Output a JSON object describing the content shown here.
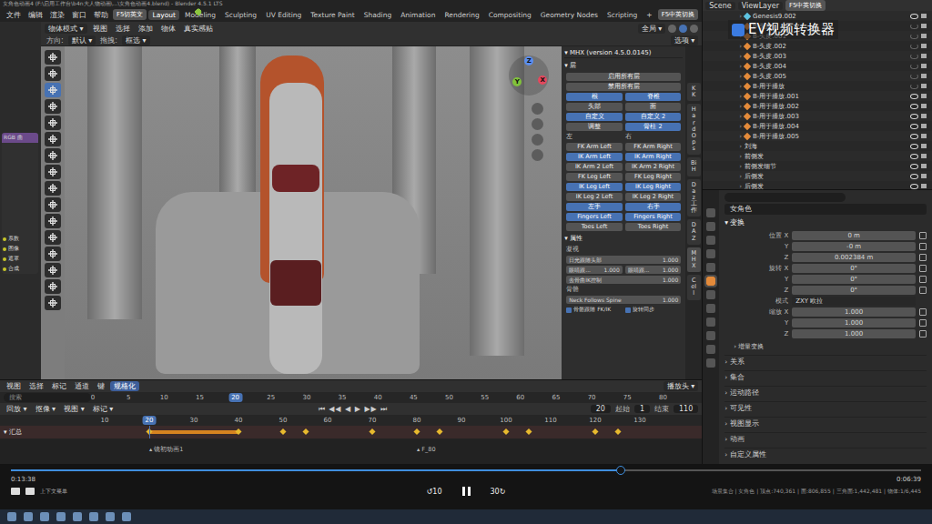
{
  "window": {
    "title": "女角色动画4 (F:\\启用工作台\\b4n大人物动画\\...\\女角色动画4.blend) - Blender 4.5.1 LTS"
  },
  "menu": [
    "文件",
    "编辑",
    "渲染",
    "窗口",
    "帮助"
  ],
  "lang_switch": "F5切英文",
  "workspaces": [
    {
      "label": "Layout",
      "selected": true
    },
    {
      "label": "Modeling",
      "selected": false
    },
    {
      "label": "Sculpting",
      "selected": false
    },
    {
      "label": "UV Editing",
      "selected": false
    },
    {
      "label": "Texture Paint",
      "selected": false
    },
    {
      "label": "Shading",
      "selected": false
    },
    {
      "label": "Animation",
      "selected": false
    },
    {
      "label": "Rendering",
      "selected": false
    },
    {
      "label": "Compositing",
      "selected": false
    },
    {
      "label": "Geometry Nodes",
      "selected": false
    },
    {
      "label": "Scripting",
      "selected": false
    }
  ],
  "add_workspace": "+",
  "toggle_center": "F5中英切换",
  "scene": "Scene",
  "view_layer": "ViewLayer",
  "toggle_right": "F5中英切换",
  "watermark": "EV视频转换器",
  "node_strip": {
    "header": "RGB 曲",
    "sockets": [
      "系数",
      "图像",
      "遮罩",
      "合成"
    ]
  },
  "viewport": {
    "mode": "物体模式",
    "menus": [
      "视图",
      "选择",
      "添加",
      "物体",
      "真实感贴"
    ],
    "orientation_label": "方向:",
    "orientation": "默认",
    "drag_label": "拖拽:",
    "drag": "框选",
    "transform": "全局",
    "options": "选项",
    "tools": [
      {
        "selected": false
      },
      {
        "selected": false
      },
      {
        "selected": true
      },
      {
        "selected": false
      },
      {
        "selected": false
      },
      {
        "selected": false
      },
      {
        "selected": false
      },
      {
        "selected": false
      },
      {
        "selected": false
      },
      {
        "selected": false
      },
      {
        "selected": false
      },
      {
        "selected": false
      },
      {
        "selected": false
      },
      {
        "selected": false
      },
      {
        "selected": false
      },
      {
        "selected": false
      }
    ],
    "gizmo": {
      "x": "X",
      "y": "Y",
      "z": "Z"
    }
  },
  "mhx": {
    "title": "MHX (version 4.5.0.0145)",
    "layers_label": "层",
    "enable_all": "启用所有层",
    "disable_all": "禁用所有层",
    "layer_buttons": [
      {
        "label": "根",
        "selected": true
      },
      {
        "label": "脊椎",
        "selected": true
      },
      {
        "label": "头部",
        "selected": false
      },
      {
        "label": "面",
        "selected": false
      },
      {
        "label": "自定义",
        "selected": true
      },
      {
        "label": "自定义 2",
        "selected": true
      },
      {
        "label": "调整",
        "selected": false
      },
      {
        "label": "骨柱 2",
        "selected": true
      }
    ],
    "left_label": "左",
    "right_label": "右",
    "limb_buttons": [
      {
        "label": "FK Arm Left",
        "selected": false
      },
      {
        "label": "FK Arm Right",
        "selected": false
      },
      {
        "label": "IK Arm Left",
        "selected": true
      },
      {
        "label": "IK Arm Right",
        "selected": true
      },
      {
        "label": "IK Arm 2 Left",
        "selected": false
      },
      {
        "label": "IK Arm 2 Right",
        "selected": false
      },
      {
        "label": "FK Leg Left",
        "selected": false
      },
      {
        "label": "FK Leg Right",
        "selected": false
      },
      {
        "label": "IK Leg Left",
        "selected": true
      },
      {
        "label": "IK Leg Right",
        "selected": true
      },
      {
        "label": "IK Leg 2 Left",
        "selected": false
      },
      {
        "label": "IK Leg 2 Right",
        "selected": false
      },
      {
        "label": "左手",
        "selected": true
      },
      {
        "label": "右手",
        "selected": true
      },
      {
        "label": "Fingers Left",
        "selected": true
      },
      {
        "label": "Fingers Right",
        "selected": true
      },
      {
        "label": "Toes Left",
        "selected": false
      },
      {
        "label": "Toes Right",
        "selected": false
      }
    ],
    "props_label": "属性",
    "gaze_label": "凝视",
    "gaze_rows": [
      [
        {
          "label": "日光跟随头部",
          "value": "1.000"
        }
      ],
      [
        {
          "label": "眼睛跟...",
          "value": "1.000"
        },
        {
          "label": "眼睛跟...",
          "value": "1.000"
        }
      ],
      [
        {
          "label": "去骨曲IK控制",
          "value": "1.000"
        }
      ]
    ],
    "bones_label": "骨骼",
    "neck": {
      "label": "Neck Follows Spine",
      "value": "1.000"
    },
    "checks": [
      {
        "label": "骨骼跟随 FK/IK",
        "checked": true
      },
      {
        "label": "旋转同步",
        "checked": true
      }
    ]
  },
  "side_tabs": [
    {
      "label": "KK",
      "selected": false
    },
    {
      "label": "HardOps",
      "selected": false
    },
    {
      "label": "BiH",
      "selected": false
    },
    {
      "label": "Daz 工作",
      "selected": false
    },
    {
      "label": "DAZ",
      "selected": false
    },
    {
      "label": "MHX",
      "selected": true
    },
    {
      "label": "Cell",
      "selected": false
    }
  ],
  "outliner": {
    "items": [
      {
        "name": "Genesis9.002",
        "kind": "armature",
        "visible": true
      },
      {
        "name": "B-头皮",
        "kind": "mesh",
        "visible": false
      },
      {
        "name": "B-头皮.001",
        "kind": "mesh",
        "visible": false
      },
      {
        "name": "B-头皮.002",
        "kind": "mesh",
        "visible": false
      },
      {
        "name": "B-头皮.003",
        "kind": "mesh",
        "visible": false
      },
      {
        "name": "B-头皮.004",
        "kind": "mesh",
        "visible": false
      },
      {
        "name": "B-头皮.005",
        "kind": "mesh",
        "visible": false
      },
      {
        "name": "B-用于播放",
        "kind": "mesh",
        "visible": false
      },
      {
        "name": "B-用于播放.001",
        "kind": "mesh",
        "visible": true
      },
      {
        "name": "B-用于播放.002",
        "kind": "mesh",
        "visible": true
      },
      {
        "name": "B-用于播放.003",
        "kind": "mesh",
        "visible": true
      },
      {
        "name": "B-用于播放.004",
        "kind": "mesh",
        "visible": true
      },
      {
        "name": "B-用于播放.005",
        "kind": "mesh",
        "visible": true
      },
      {
        "name": "刘海",
        "kind": "hair",
        "visible": true
      },
      {
        "name": "前侧发",
        "kind": "hair",
        "visible": true
      },
      {
        "name": "前侧发细节",
        "kind": "hair",
        "visible": true
      },
      {
        "name": "后侧发",
        "kind": "hair",
        "visible": true
      },
      {
        "name": "后侧发",
        "kind": "hair",
        "visible": true
      }
    ]
  },
  "properties": {
    "object": "女角色",
    "section": "变换",
    "rows": [
      {
        "label": "位置 X",
        "value": "0 m"
      },
      {
        "label": "Y",
        "value": "-0 m"
      },
      {
        "label": "Z",
        "value": "0.002384 m"
      },
      {
        "label": "旋转 X",
        "value": "0°"
      },
      {
        "label": "Y",
        "value": "0°"
      },
      {
        "label": "Z",
        "value": "0°"
      }
    ],
    "mode_label": "模式",
    "mode": "ZXY 欧拉",
    "scale_rows": [
      {
        "label": "缩放 X",
        "value": "1.000"
      },
      {
        "label": "Y",
        "value": "1.000"
      },
      {
        "label": "Z",
        "value": "1.000"
      }
    ],
    "sub_section": "增量变换",
    "sections": [
      "关系",
      "集合",
      "运动路径",
      "可见性",
      "视图显示",
      "动画",
      "自定义属性"
    ],
    "tabs": [
      {
        "selected": false
      },
      {
        "selected": false
      },
      {
        "selected": false
      },
      {
        "selected": false
      },
      {
        "selected": false
      },
      {
        "selected": true
      },
      {
        "selected": false
      },
      {
        "selected": false
      },
      {
        "selected": false
      },
      {
        "selected": false
      },
      {
        "selected": false
      },
      {
        "selected": false
      }
    ]
  },
  "dopesheet": {
    "menus": [
      "视图",
      "选择",
      "标记",
      "通道",
      "键"
    ],
    "normalize": "规格化",
    "playhead": "播放头",
    "search": "搜索",
    "ticks": [
      0,
      5,
      10,
      15,
      20,
      25,
      30,
      35,
      40,
      45,
      50,
      55,
      60,
      65,
      70,
      75,
      80
    ],
    "current": 20
  },
  "timeline": {
    "menus": [
      "回放",
      "抠像",
      "视图",
      "标记"
    ],
    "frame": "20",
    "start_label": "起始",
    "start": "1",
    "end_label": "结束",
    "end": "110",
    "ticks": [
      10,
      20,
      30,
      40,
      50,
      60,
      70,
      80,
      90,
      100,
      110,
      120,
      130
    ],
    "current": 20,
    "summary": "汇总",
    "keyframes": [
      20,
      40,
      50,
      55,
      70,
      80,
      85,
      100,
      105,
      120,
      125
    ],
    "holds": [
      [
        20,
        40
      ]
    ],
    "markers": [
      {
        "label": "镜初动画1",
        "frame": 20
      },
      {
        "label": "F_80",
        "frame": 80
      }
    ]
  },
  "player": {
    "elapsed": "0:13:38",
    "remaining": "0:06:39",
    "level": 0.67,
    "back": "10",
    "forward": "30",
    "hint": "上下文菜单",
    "status": "场景集合 | 女角色 | 顶点:740,361 | 面:806,855 | 三角面:1,442,481 | 物体:1/6,445"
  }
}
